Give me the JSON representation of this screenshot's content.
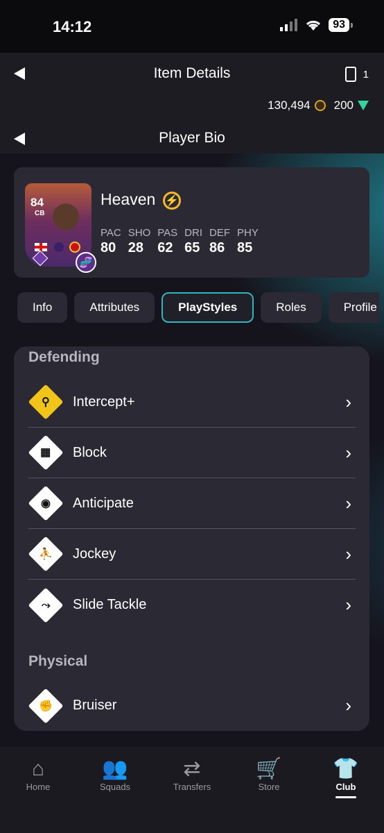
{
  "status": {
    "time": "14:12",
    "battery": "93"
  },
  "header": {
    "title": "Item Details",
    "card_count": "1",
    "coins": "130,494",
    "points": "200",
    "sub_title": "Player Bio"
  },
  "player": {
    "name": "Heaven",
    "rating": "84",
    "position": "CB",
    "stats": [
      {
        "label": "PAC",
        "value": "80"
      },
      {
        "label": "SHO",
        "value": "28"
      },
      {
        "label": "PAS",
        "value": "62"
      },
      {
        "label": "DRI",
        "value": "65"
      },
      {
        "label": "DEF",
        "value": "86"
      },
      {
        "label": "PHY",
        "value": "85"
      }
    ]
  },
  "tabs": [
    "Info",
    "Attributes",
    "PlayStyles",
    "Roles",
    "Profile"
  ],
  "active_tab": "PlayStyles",
  "playstyles": {
    "defending_title": "Defending",
    "defending": [
      "Intercept+",
      "Block",
      "Anticipate",
      "Jockey",
      "Slide Tackle"
    ],
    "physical_title": "Physical",
    "physical": [
      "Bruiser"
    ]
  },
  "nav": {
    "items": [
      "Home",
      "Squads",
      "Transfers",
      "Store",
      "Club"
    ],
    "active": "Club"
  },
  "colors": {
    "accent": "#34b3c0",
    "plus_gold": "#f0c419",
    "points_green": "#35d39b"
  }
}
